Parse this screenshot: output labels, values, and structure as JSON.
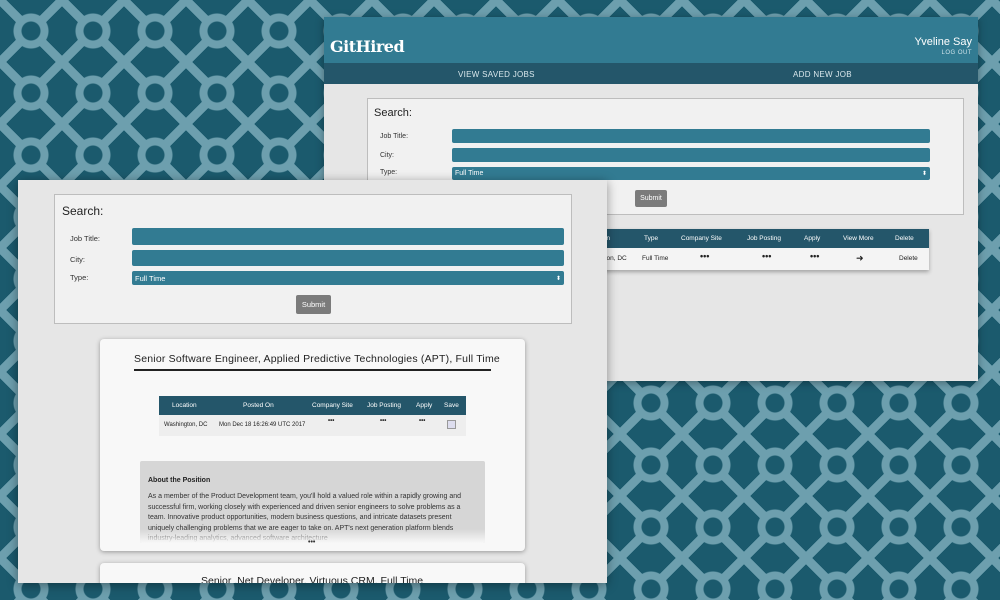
{
  "back_window": {
    "app_logo": "GitHired",
    "user_name": "Yveline Say",
    "logout_label": "LOG OUT",
    "nav": {
      "saved_jobs": "VIEW SAVED JOBS",
      "add_job": "ADD NEW JOB"
    },
    "search": {
      "title": "Search:",
      "job_title_label": "Job Title:",
      "city_label": "City:",
      "type_label": "Type:",
      "type_value": "Full Time",
      "submit_label": "Submit"
    },
    "results": {
      "headers": [
        "ation",
        "Type",
        "Company Site",
        "Job Posting",
        "Apply",
        "View More",
        "Delete"
      ],
      "row": {
        "location": "ington, DC",
        "type": "Full Time",
        "company_site": "•••",
        "job_posting": "•••",
        "apply": "•••",
        "delete": "Delete"
      }
    }
  },
  "front_window": {
    "search": {
      "title": "Search:",
      "job_title_label": "Job Title:",
      "city_label": "City:",
      "type_label": "Type:",
      "type_value": "Full Time",
      "submit_label": "Submit"
    },
    "job_card": {
      "title": "Senior Software Engineer, Applied Predictive Technologies (APT), Full Time",
      "headers": [
        "Location",
        "Posted On",
        "Company Site",
        "Job Posting",
        "Apply",
        "Save"
      ],
      "row": {
        "location": "Washington, DC",
        "posted_on": "Mon Dec 18 16:26:49 UTC 2017",
        "company_site": "•••",
        "job_posting": "•••",
        "apply": "•••"
      },
      "about_title": "About the Position",
      "about_text": "As a member of the Product Development team, you'll hold a valued role within a rapidly growing and successful firm, working closely with experienced and driven senior engineers to solve problems as a team. Innovative product opportunities, modern business questions, and intricate datasets present uniquely challenging problems that we are eager to take on. APT's next generation platform blends industry-leading analytics, advanced software architecture",
      "more_dots": "•••"
    },
    "job_card_2": {
      "title": "Senior .Net Developer, Virtuous CRM, Full Time"
    }
  }
}
